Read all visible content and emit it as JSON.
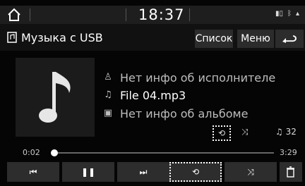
{
  "status": {
    "clock": "18:37",
    "icons": [
      "home-icon",
      "battery-icon",
      "bluetooth-icon",
      "signal-icon"
    ]
  },
  "titlebar": {
    "source_title": "Музыка с USB",
    "list_label": "Список",
    "menu_label": "Меню"
  },
  "track": {
    "artist": "Нет инфо об исполнителе",
    "file": "File 04.mp3",
    "album": "Нет инфо об альбоме",
    "count": "32"
  },
  "progress": {
    "elapsed": "0:02",
    "total": "3:29",
    "fraction": 0.01
  },
  "colors": {
    "background": "#050505",
    "button": "#2d2d2d",
    "text": "#ffffff",
    "muted": "#bdbdbd"
  }
}
